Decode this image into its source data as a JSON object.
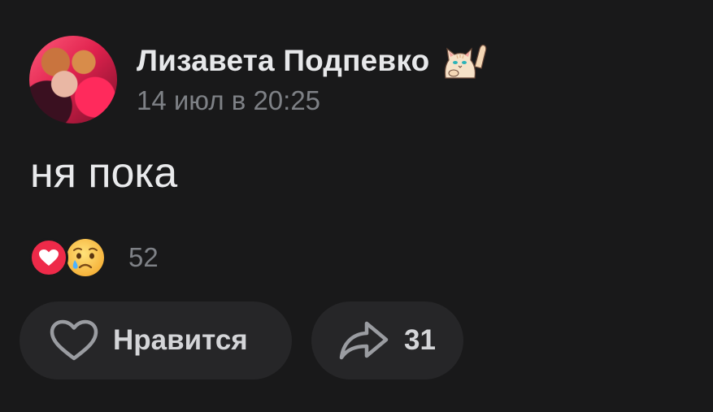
{
  "post": {
    "author_name": "Лизавета Подпевко",
    "date": "14 июл в 20:25",
    "text": "ня пока"
  },
  "reactions": {
    "icons": [
      "heart-reaction-icon",
      "crying-face-reaction-icon"
    ],
    "count": "52"
  },
  "actions": {
    "like_label": "Нравится",
    "share_count": "31"
  },
  "colors": {
    "background": "#19191a",
    "pill_background": "#262628",
    "primary_text": "#e9eaec",
    "secondary_text": "#7e8186",
    "heart_red": "#ee2a49"
  }
}
